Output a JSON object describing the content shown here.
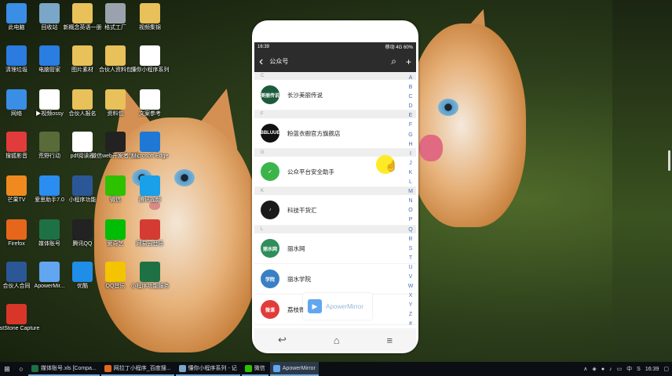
{
  "desktop_icons": [
    {
      "label": "此电脑",
      "icon": "computer-icon",
      "color": "#3a8ee6"
    },
    {
      "label": "回收站",
      "icon": "recycle-bin-icon",
      "color": "#7aa7c7"
    },
    {
      "label": "新概念英语一册",
      "icon": "folder-icon",
      "color": "#e8c15a"
    },
    {
      "label": "格式工厂",
      "icon": "format-factory-icon",
      "color": "#9aa3ad"
    },
    {
      "label": "视频集锦",
      "icon": "folder-icon",
      "color": "#e8c15a"
    },
    {
      "label": "清理垃圾",
      "icon": "cleanup-icon",
      "color": "#2b7be0"
    },
    {
      "label": "电脑管家",
      "icon": "pc-manager-icon",
      "color": "#2a7de1"
    },
    {
      "label": "图片素材",
      "icon": "folder-icon",
      "color": "#e8c15a"
    },
    {
      "label": "合伙人资料包",
      "icon": "folder-icon",
      "color": "#e8c15a"
    },
    {
      "label": "懂你小程序系列",
      "icon": "document-icon",
      "color": "#ffffff"
    },
    {
      "label": "网络",
      "icon": "network-icon",
      "color": "#3a8ee6"
    },
    {
      "label": "▶视频ossy",
      "icon": "document-icon",
      "color": "#ffffff"
    },
    {
      "label": "合伙人报名",
      "icon": "folder-icon",
      "color": "#e8c15a"
    },
    {
      "label": "资料包",
      "icon": "folder-icon",
      "color": "#e8c15a"
    },
    {
      "label": "文案参考",
      "icon": "document-icon",
      "color": "#ffffff"
    },
    {
      "label": "搜狐影音",
      "icon": "sohu-video-icon",
      "color": "#e23b3b"
    },
    {
      "label": "荒野行动",
      "icon": "game-icon",
      "color": "#5a6b3a"
    },
    {
      "label": "pdf阅读器",
      "icon": "pdf-icon",
      "color": "#ffffff"
    },
    {
      "label": "微信web开发者工具",
      "icon": "wechat-devtools-icon",
      "color": "#222222"
    },
    {
      "label": "Microsoft Edge",
      "icon": "edge-icon",
      "color": "#1e78d4"
    },
    {
      "label": "芒果TV",
      "icon": "mango-tv-icon",
      "color": "#f08a1e"
    },
    {
      "label": "爱思助手7.0",
      "icon": "i4-icon",
      "color": "#2c8df0"
    },
    {
      "label": "小程序功能",
      "icon": "word-icon",
      "color": "#2b5797"
    },
    {
      "label": "微信",
      "icon": "wechat-icon",
      "color": "#2dc100"
    },
    {
      "label": "腾讯视频",
      "icon": "tencent-video-icon",
      "color": "#1aa0e8"
    },
    {
      "label": "Firefox",
      "icon": "firefox-icon",
      "color": "#e6671c"
    },
    {
      "label": "媒体账号",
      "icon": "excel-icon",
      "color": "#1e7145"
    },
    {
      "label": "腾讯QQ",
      "icon": "qq-icon",
      "color": "#222222"
    },
    {
      "label": "爱奇艺",
      "icon": "iqiyi-icon",
      "color": "#00be06"
    },
    {
      "label": "网易云音乐",
      "icon": "netease-music-icon",
      "color": "#d43c33"
    },
    {
      "label": "合伙人合同",
      "icon": "word-icon",
      "color": "#2b5797"
    },
    {
      "label": "ApowerMir...",
      "icon": "apowermirror-icon",
      "color": "#62a6ef"
    },
    {
      "label": "优酷",
      "icon": "youku-icon",
      "color": "#1f8ee8"
    },
    {
      "label": "QQ音乐",
      "icon": "qq-music-icon",
      "color": "#f5c400"
    },
    {
      "label": "小程序功能服务",
      "icon": "excel-icon",
      "color": "#1e7145"
    },
    {
      "label": "FastStone Capture",
      "icon": "faststone-icon",
      "color": "#d9362a"
    }
  ],
  "phone": {
    "status_time": "16:39",
    "status_right": "移动 4G 60%",
    "nav_title": "公众号",
    "sections": [
      {
        "letter": "C",
        "items": [
          {
            "name": "长沙美丽传说",
            "avatar_text": "美丽传说",
            "avatar_color": "#1e5a3c"
          }
        ]
      },
      {
        "letter": "F",
        "items": [
          {
            "name": "粉蓝衣橱官方旗舰店",
            "avatar_text": "BBLUUE",
            "avatar_color": "#111111"
          }
        ]
      },
      {
        "letter": "G",
        "items": [
          {
            "name": "公众平台安全助手",
            "avatar_text": "✓",
            "avatar_color": "#3bb54a"
          }
        ]
      },
      {
        "letter": "K",
        "items": [
          {
            "name": "科技干货汇",
            "avatar_text": "♪",
            "avatar_color": "#1a1a1a"
          }
        ]
      },
      {
        "letter": "L",
        "items": [
          {
            "name": "丽水网",
            "avatar_text": "丽水网",
            "avatar_color": "#2f8e5a"
          },
          {
            "name": "丽水学院",
            "avatar_text": "学院",
            "avatar_color": "#3a7fc4"
          },
          {
            "name": "荔枝微课",
            "avatar_text": "微课",
            "avatar_color": "#e23b3b"
          }
        ]
      }
    ],
    "alphabet": [
      "A",
      "B",
      "C",
      "D",
      "E",
      "F",
      "G",
      "H",
      "I",
      "J",
      "K",
      "L",
      "M",
      "N",
      "O",
      "P",
      "Q",
      "R",
      "S",
      "T",
      "U",
      "V",
      "W",
      "X",
      "Y",
      "Z",
      "#"
    ]
  },
  "watermark": {
    "text": "ApowerMirror"
  },
  "taskbar": {
    "items": [
      {
        "label": "媒体账号.xls [Compa...",
        "color": "#1e7145"
      },
      {
        "label": "网拉丁小程序_百度搜...",
        "color": "#e6671c"
      },
      {
        "label": "懂你小程序系列 - 记",
        "color": "#7aa7c7"
      },
      {
        "label": "微信",
        "color": "#2dc100"
      },
      {
        "label": "ApowerMirror",
        "color": "#62a6ef"
      }
    ],
    "tray_lang": "中",
    "clock": "16:39"
  }
}
